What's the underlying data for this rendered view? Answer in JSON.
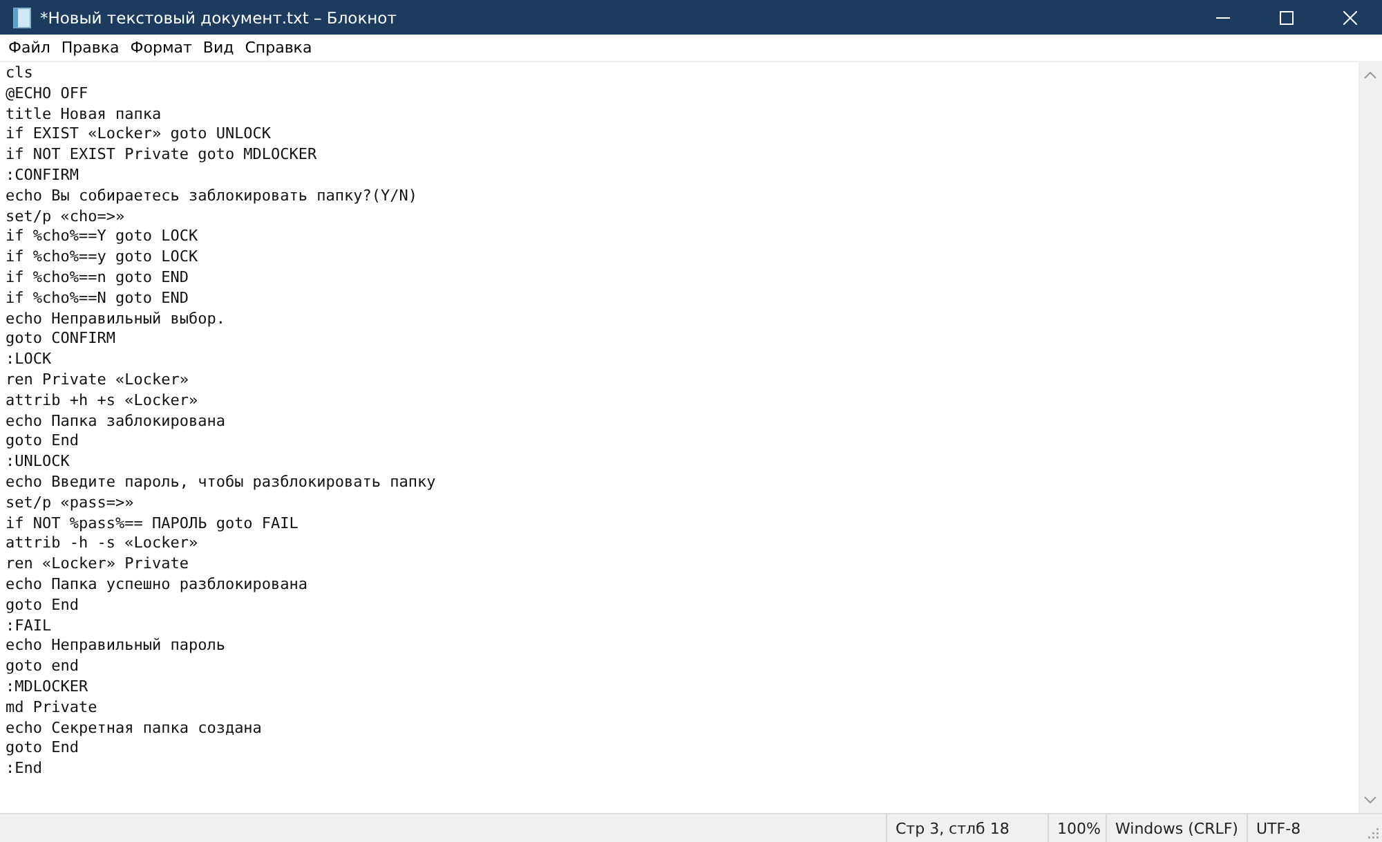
{
  "window": {
    "title": "*Новый текстовый документ.txt – Блокнот"
  },
  "menu": [
    "Файл",
    "Правка",
    "Формат",
    "Вид",
    "Справка"
  ],
  "editor": {
    "lines": [
      "cls",
      "@ECHO OFF",
      "title Новая папка",
      "if EXIST «Locker» goto UNLOCK",
      "if NOT EXIST Private goto MDLOCKER",
      ":CONFIRM",
      "echo Вы собираетесь заблокировать папку?(Y/N)",
      "set/p «cho=>»",
      "if %cho%==Y goto LOCK",
      "if %cho%==y goto LOCK",
      "if %cho%==n goto END",
      "if %cho%==N goto END",
      "echo Неправильный выбор.",
      "goto CONFIRM",
      ":LOCK",
      "ren Private «Locker»",
      "attrib +h +s «Locker»",
      "echo Папка заблокирована",
      "goto End",
      ":UNLOCK",
      "echo Введите пароль, чтобы разблокировать папку",
      "set/p «pass=>»",
      "if NOT %pass%== ПАРОЛЬ goto FAIL",
      "attrib -h -s «Locker»",
      "ren «Locker» Private",
      "echo Папка успешно разблокирована",
      "goto End",
      ":FAIL",
      "echo Неправильный пароль",
      "goto end",
      ":MDLOCKER",
      "md Private",
      "echo Секретная папка создана",
      "goto End",
      ":End"
    ]
  },
  "status_bar": {
    "position": "Стр 3, стлб 18",
    "zoom": "100%",
    "line_endings": "Windows (CRLF)",
    "encoding": "UTF-8"
  }
}
